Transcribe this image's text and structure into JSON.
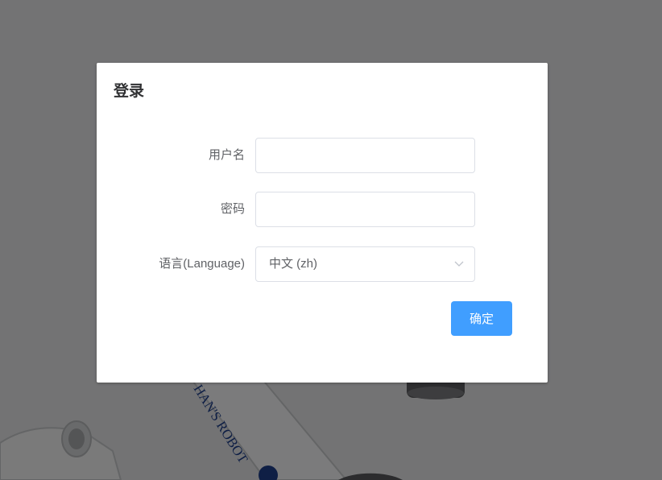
{
  "dialog": {
    "title": "登录",
    "fields": {
      "username_label": "用户名",
      "username_value": "",
      "password_label": "密码",
      "password_value": "",
      "language_label": "语言(Language)",
      "language_selected": "中文 (zh)"
    },
    "confirm_label": "确定"
  },
  "background": {
    "robot_arm_text": "HAN'S ROBOT"
  },
  "colors": {
    "primary": "#409eff",
    "overlay": "rgba(0,0,0,0.5)",
    "border": "#dcdfe6",
    "label_text": "#606266",
    "title_text": "#303133"
  }
}
